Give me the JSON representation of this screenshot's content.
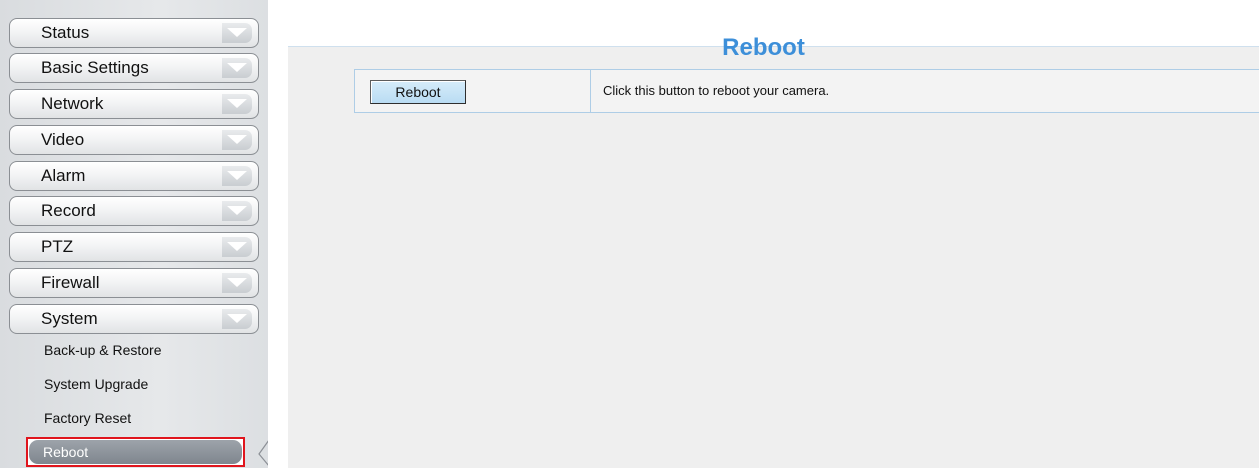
{
  "sidebar": {
    "menu": [
      {
        "label": "Status"
      },
      {
        "label": "Basic Settings"
      },
      {
        "label": "Network"
      },
      {
        "label": "Video"
      },
      {
        "label": "Alarm"
      },
      {
        "label": "Record"
      },
      {
        "label": "PTZ"
      },
      {
        "label": "Firewall"
      },
      {
        "label": "System"
      }
    ],
    "submenu": [
      {
        "label": "Back-up & Restore"
      },
      {
        "label": "System Upgrade"
      },
      {
        "label": "Factory Reset"
      },
      {
        "label": "Reboot",
        "active": true
      }
    ]
  },
  "main": {
    "title": "Reboot",
    "action": {
      "button_label": "Reboot",
      "description": "Click this button to reboot your camera."
    }
  },
  "colors": {
    "title": "#3d8fd9",
    "active_highlight_border": "#e0151d",
    "row_border": "#aecde6",
    "button_fill": "#c8e5f7"
  },
  "icons": {
    "menu_expand": "chevron-down-icon",
    "sidebar_collapse": "chevron-left-icon"
  }
}
